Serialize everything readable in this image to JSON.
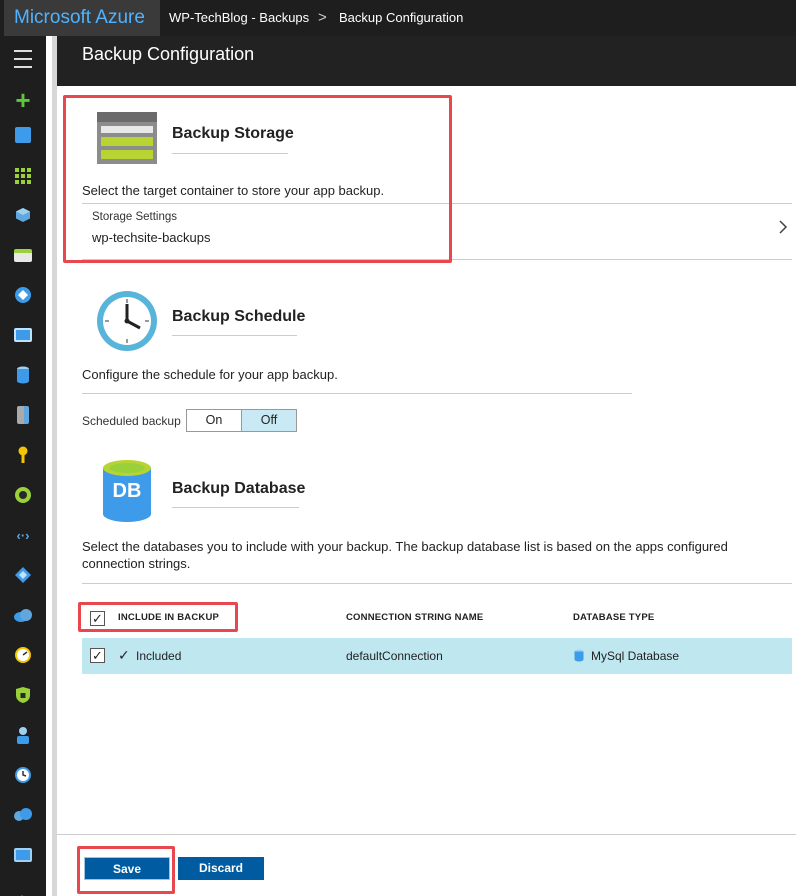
{
  "topbar": {
    "brand": "Microsoft Azure",
    "breadcrumbs": [
      "WP-TechBlog - Backups",
      "Backup Configuration"
    ],
    "separator": ">"
  },
  "blade": {
    "title": "Backup Configuration"
  },
  "storage": {
    "title": "Backup Storage",
    "description": "Select the target container to store your app backup.",
    "settings_label": "Storage Settings",
    "settings_value": "wp-techsite-backups",
    "icon": "storage-icon"
  },
  "schedule": {
    "title": "Backup Schedule",
    "description": "Configure the schedule for your app backup.",
    "label": "Scheduled backup",
    "on_label": "On",
    "off_label": "Off",
    "selected": "Off",
    "icon": "clock-icon"
  },
  "database": {
    "title": "Backup Database",
    "icon_text": "DB",
    "description_line1": "Select the databases you to include with your backup. The backup database list is based on the apps configured",
    "description_line2": "connection strings.",
    "columns": [
      "INCLUDE IN BACKUP",
      "CONNECTION STRING NAME",
      "DATABASE TYPE"
    ],
    "rows": [
      {
        "included": "Included",
        "connection": "defaultConnection",
        "type": "MySql Database",
        "checked": true
      }
    ]
  },
  "footer": {
    "save_label": "Save",
    "discard_label": "Discard"
  },
  "colors": {
    "accent": "#005ba1",
    "highlight_box": "#e8484d",
    "row_selected": "#bfe7f0",
    "azure_blue": "#4fb3ff"
  }
}
